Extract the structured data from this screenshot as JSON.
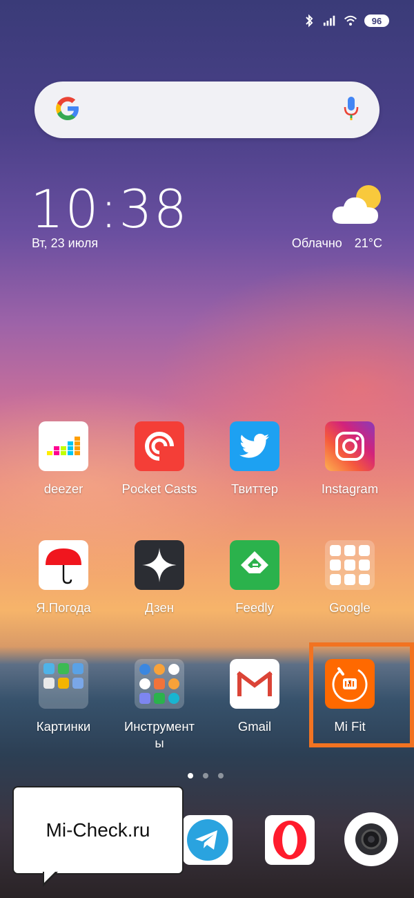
{
  "status_bar": {
    "battery": "96",
    "icons": [
      "bluetooth-icon",
      "signal-icon",
      "wifi-icon",
      "battery-icon"
    ]
  },
  "search": {
    "placeholder": "",
    "icons": [
      "google-g-icon",
      "microphone-icon"
    ]
  },
  "clock_widget": {
    "time": "10:38",
    "date": "Вт, 23 июля",
    "weather_condition": "Облачно",
    "temperature": "21°C"
  },
  "apps": [
    {
      "label": "deezer",
      "icon": "deezer-icon"
    },
    {
      "label": "Pocket Casts",
      "icon": "pocket-casts-icon"
    },
    {
      "label": "Твиттер",
      "icon": "twitter-icon"
    },
    {
      "label": "Instagram",
      "icon": "instagram-icon"
    },
    {
      "label": "Я.Погода",
      "icon": "umbrella-icon"
    },
    {
      "label": "Дзен",
      "icon": "zen-star-icon"
    },
    {
      "label": "Feedly",
      "icon": "feedly-icon"
    },
    {
      "label": "Google",
      "icon": "google-folder-icon"
    },
    {
      "label": "Картинки",
      "icon": "pictures-folder-icon"
    },
    {
      "label": "Инструмент\nы",
      "icon": "tools-folder-icon"
    },
    {
      "label": "Gmail",
      "icon": "gmail-icon"
    },
    {
      "label": "Mi Fit",
      "icon": "mi-fit-icon"
    }
  ],
  "page_indicator": {
    "count": 3,
    "active": 0
  },
  "dock": [
    "telegram-icon",
    "opera-icon",
    "camera-icon"
  ],
  "callout": {
    "text": "Mi-Check.ru"
  },
  "colors": {
    "highlight": "#f27321",
    "google_blue": "#4285f4",
    "pocket_casts": "#f43e37",
    "twitter": "#1da1f2",
    "feedly": "#2bb24c",
    "mi_fit": "#ff6900"
  }
}
